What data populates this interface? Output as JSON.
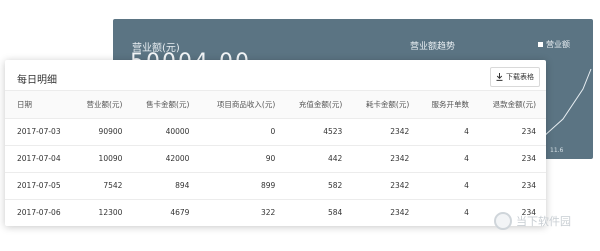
{
  "background_card": {
    "revenue_label": "营业额(元)",
    "revenue_value_partial": "50004.00",
    "trend_title": "营业额趋势",
    "legend_label": "营业额",
    "axis_tick": "11.6",
    "color": "#5b7483"
  },
  "daily_detail": {
    "title": "每日明细",
    "download_label": "下载表格",
    "download_icon": "download-icon",
    "columns": [
      "日期",
      "营业额(元)",
      "售卡金额(元)",
      "项目商品收入(元)",
      "充值金额(元)",
      "耗卡金额(元)",
      "服务开单数",
      "退款金额(元)"
    ],
    "rows": [
      [
        "2017-07-03",
        "90900",
        "40000",
        "0",
        "4523",
        "2342",
        "4",
        "234"
      ],
      [
        "2017-07-04",
        "10090",
        "42000",
        "90",
        "442",
        "2342",
        "4",
        "234"
      ],
      [
        "2017-07-05",
        "7542",
        "894",
        "899",
        "582",
        "2342",
        "4",
        "234"
      ],
      [
        "2017-07-06",
        "12300",
        "4679",
        "322",
        "584",
        "2342",
        "4",
        "234"
      ]
    ]
  },
  "watermark": {
    "text": "当下软件园"
  }
}
